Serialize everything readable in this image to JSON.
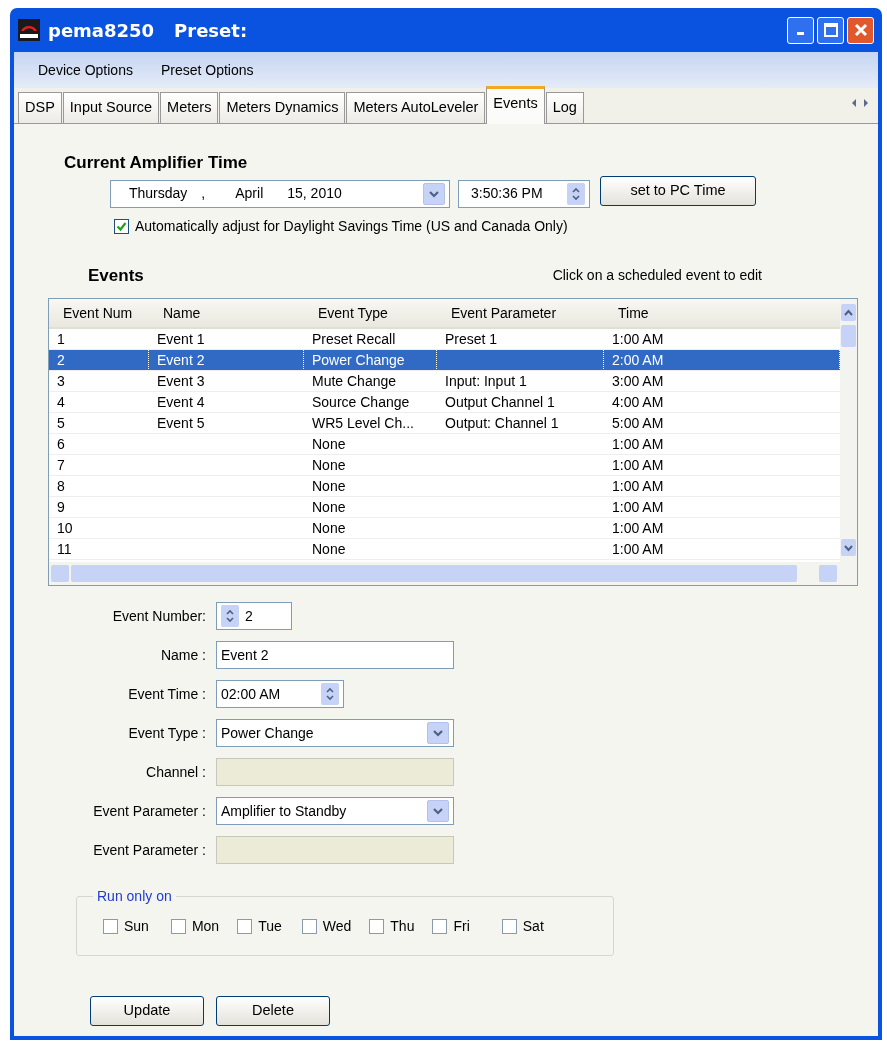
{
  "window": {
    "title": "pema8250",
    "subtitle": "Preset:"
  },
  "menu": [
    "Device Options",
    "Preset Options"
  ],
  "tabs": [
    {
      "label": "DSP",
      "selected": false
    },
    {
      "label": "Input Source",
      "selected": false
    },
    {
      "label": "Meters",
      "selected": false
    },
    {
      "label": "Meters Dynamics",
      "selected": false
    },
    {
      "label": "Meters AutoLeveler",
      "selected": false
    },
    {
      "label": "Events",
      "selected": true
    },
    {
      "label": "Log",
      "selected": false
    }
  ],
  "amplifier_time": {
    "heading": "Current Amplifier Time",
    "date_parts": [
      "Thursday",
      ",",
      "April",
      "15, 2010"
    ],
    "time": "3:50:36 PM",
    "button": "set to PC Time",
    "dst": {
      "label": "Automatically adjust for Daylight Savings Time (US and Canada Only)",
      "checked": true
    }
  },
  "events": {
    "heading": "Events",
    "hint": "Click on a scheduled event to edit",
    "columns": [
      "Event Num",
      "Name",
      "Event Type",
      "Event Parameter",
      "Time"
    ],
    "rows": [
      {
        "cells": [
          "1",
          "Event 1",
          "Preset Recall",
          "Preset 1",
          "1:00 AM"
        ],
        "selected": false
      },
      {
        "cells": [
          "2",
          "Event 2",
          "Power Change",
          "",
          "2:00 AM"
        ],
        "selected": true
      },
      {
        "cells": [
          "3",
          "Event 3",
          "Mute Change",
          "Input: Input 1",
          "3:00 AM"
        ],
        "selected": false
      },
      {
        "cells": [
          "4",
          "Event 4",
          "Source Change",
          "Output Channel 1",
          "4:00 AM"
        ],
        "selected": false
      },
      {
        "cells": [
          "5",
          "Event 5",
          "WR5 Level Ch...",
          "Output: Channel 1",
          "5:00 AM"
        ],
        "selected": false
      },
      {
        "cells": [
          "6",
          "",
          "None",
          "",
          "1:00 AM"
        ],
        "selected": false
      },
      {
        "cells": [
          "7",
          "",
          "None",
          "",
          "1:00 AM"
        ],
        "selected": false
      },
      {
        "cells": [
          "8",
          "",
          "None",
          "",
          "1:00 AM"
        ],
        "selected": false
      },
      {
        "cells": [
          "9",
          "",
          "None",
          "",
          "1:00 AM"
        ],
        "selected": false
      },
      {
        "cells": [
          "10",
          "",
          "None",
          "",
          "1:00 AM"
        ],
        "selected": false
      },
      {
        "cells": [
          "11",
          "",
          "None",
          "",
          "1:00 AM"
        ],
        "selected": false
      }
    ]
  },
  "editor": [
    {
      "label": "Event Number:",
      "kind": "spin",
      "value": "2",
      "disabled": false
    },
    {
      "label": "Name :",
      "kind": "text",
      "value": "Event 2",
      "disabled": false
    },
    {
      "label": "Event Time :",
      "kind": "time",
      "value": "02:00 AM",
      "disabled": false
    },
    {
      "label": "Event Type :",
      "kind": "select",
      "value": "Power Change",
      "disabled": false
    },
    {
      "label": "Channel :",
      "kind": "select",
      "disabled": true
    },
    {
      "label": "Event Parameter :",
      "kind": "select",
      "value": "Amplifier to Standby",
      "disabled": false
    },
    {
      "label": "Event Parameter :",
      "kind": "select",
      "disabled": true
    }
  ],
  "run_only_on": {
    "legend": "Run only on",
    "days": [
      {
        "label": "Sun",
        "checked": false
      },
      {
        "label": "Mon",
        "checked": false
      },
      {
        "label": "Tue",
        "checked": false
      },
      {
        "label": "Wed",
        "checked": false
      },
      {
        "label": "Thu",
        "checked": false
      },
      {
        "label": "Fri",
        "checked": false
      },
      {
        "label": "Sat",
        "checked": false
      }
    ]
  },
  "buttons": [
    "Update",
    "Delete"
  ]
}
